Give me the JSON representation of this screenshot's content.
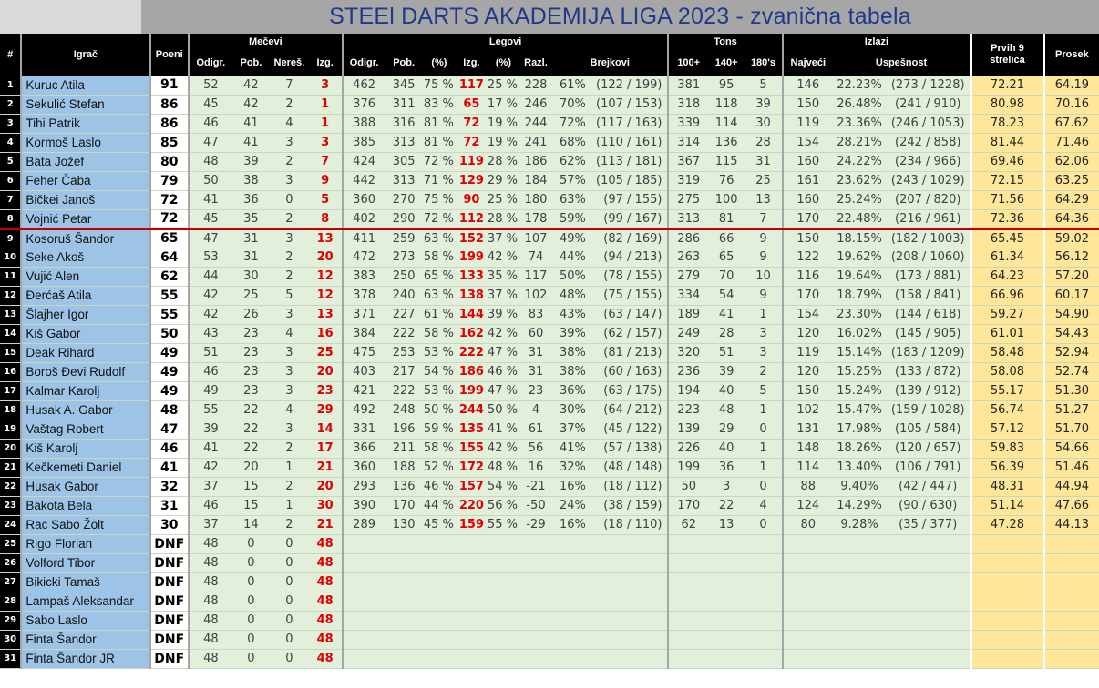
{
  "title": "STEEl DARTS AKADEMIJA LIGA 2023 - zvanična tabela",
  "colors": {
    "player_bg": "#9dc3e6",
    "stats_bg": "#e2efda",
    "highlight_bg": "#ffe699",
    "lost_red": "#e00000",
    "cut_line": "#c00000"
  },
  "headers": {
    "rank": "#",
    "player": "Igrač",
    "points": "Poeni",
    "matches": "Mečevi",
    "legs": "Legovi",
    "tons": "Tons",
    "checkouts": "Izlazi",
    "first9": "Prvih 9 strelica",
    "average": "Prosek",
    "m_played": "Odigr.",
    "m_won": "Pob.",
    "m_draw": "Nereš.",
    "m_lost": "Izg.",
    "l_played": "Odigr.",
    "l_won": "Pob.",
    "l_won_pct": "(%)",
    "l_lost": "Izg.",
    "l_lost_pct": "(%)",
    "l_diff": "Razl.",
    "l_breaks": "Brejkovi",
    "t_100": "100+",
    "t_140": "140+",
    "t_180": "180's",
    "c_highest": "Najveći",
    "c_success": "Uspešnost"
  },
  "rows": [
    {
      "rank": "1",
      "player": "Kuruc Atila",
      "points": "91",
      "mp": "52",
      "mw": "42",
      "md": "7",
      "ml": "3",
      "lp": "462",
      "lw": "345",
      "lwp": "75 %",
      "ll": "117",
      "llp": "25 %",
      "ld": "228",
      "bp": "61%",
      "bf": "(122 / 199)",
      "t100": "381",
      "t140": "95",
      "t180": "5",
      "ch": "146",
      "cp": "22.23%",
      "cf": "(273 / 1228)",
      "f9": "72.21",
      "avg": "64.19"
    },
    {
      "rank": "2",
      "player": "Sekulić Stefan",
      "points": "86",
      "mp": "45",
      "mw": "42",
      "md": "2",
      "ml": "1",
      "lp": "376",
      "lw": "311",
      "lwp": "83 %",
      "ll": "65",
      "llp": "17 %",
      "ld": "246",
      "bp": "70%",
      "bf": "(107 / 153)",
      "t100": "318",
      "t140": "118",
      "t180": "39",
      "ch": "150",
      "cp": "26.48%",
      "cf": "(241 / 910)",
      "f9": "80.98",
      "avg": "70.16"
    },
    {
      "rank": "3",
      "player": "Tihi Patrik",
      "points": "86",
      "mp": "46",
      "mw": "41",
      "md": "4",
      "ml": "1",
      "lp": "388",
      "lw": "316",
      "lwp": "81 %",
      "ll": "72",
      "llp": "19 %",
      "ld": "244",
      "bp": "72%",
      "bf": "(117 / 163)",
      "t100": "339",
      "t140": "114",
      "t180": "30",
      "ch": "119",
      "cp": "23.36%",
      "cf": "(246 / 1053)",
      "f9": "78.23",
      "avg": "67.62"
    },
    {
      "rank": "4",
      "player": "Kormoš Laslo",
      "points": "85",
      "mp": "47",
      "mw": "41",
      "md": "3",
      "ml": "3",
      "lp": "385",
      "lw": "313",
      "lwp": "81 %",
      "ll": "72",
      "llp": "19 %",
      "ld": "241",
      "bp": "68%",
      "bf": "(110 / 161)",
      "t100": "314",
      "t140": "136",
      "t180": "28",
      "ch": "154",
      "cp": "28.21%",
      "cf": "(242 / 858)",
      "f9": "81.44",
      "avg": "71.46"
    },
    {
      "rank": "5",
      "player": "Bata Jožef",
      "points": "80",
      "mp": "48",
      "mw": "39",
      "md": "2",
      "ml": "7",
      "lp": "424",
      "lw": "305",
      "lwp": "72 %",
      "ll": "119",
      "llp": "28 %",
      "ld": "186",
      "bp": "62%",
      "bf": "(113 / 181)",
      "t100": "367",
      "t140": "115",
      "t180": "31",
      "ch": "160",
      "cp": "24.22%",
      "cf": "(234 / 966)",
      "f9": "69.46",
      "avg": "62.06"
    },
    {
      "rank": "6",
      "player": "Feher Čaba",
      "points": "79",
      "mp": "50",
      "mw": "38",
      "md": "3",
      "ml": "9",
      "lp": "442",
      "lw": "313",
      "lwp": "71 %",
      "ll": "129",
      "llp": "29 %",
      "ld": "184",
      "bp": "57%",
      "bf": "(105 / 185)",
      "t100": "319",
      "t140": "76",
      "t180": "25",
      "ch": "161",
      "cp": "23.62%",
      "cf": "(243 / 1029)",
      "f9": "72.15",
      "avg": "63.25"
    },
    {
      "rank": "7",
      "player": "Bičkei Janoš",
      "points": "72",
      "mp": "41",
      "mw": "36",
      "md": "0",
      "ml": "5",
      "lp": "360",
      "lw": "270",
      "lwp": "75 %",
      "ll": "90",
      "llp": "25 %",
      "ld": "180",
      "bp": "63%",
      "bf": "(97 / 155)",
      "t100": "275",
      "t140": "100",
      "t180": "13",
      "ch": "160",
      "cp": "25.24%",
      "cf": "(207 / 820)",
      "f9": "71.56",
      "avg": "64.29"
    },
    {
      "rank": "8",
      "player": "Vojnić Petar",
      "points": "72",
      "mp": "45",
      "mw": "35",
      "md": "2",
      "ml": "8",
      "lp": "402",
      "lw": "290",
      "lwp": "72 %",
      "ll": "112",
      "llp": "28 %",
      "ld": "178",
      "bp": "59%",
      "bf": "(99 / 167)",
      "t100": "313",
      "t140": "81",
      "t180": "7",
      "ch": "170",
      "cp": "22.48%",
      "cf": "(216 / 961)",
      "f9": "72.36",
      "avg": "64.36"
    },
    {
      "rank": "9",
      "player": "Kosoruš Šandor",
      "points": "65",
      "mp": "47",
      "mw": "31",
      "md": "3",
      "ml": "13",
      "lp": "411",
      "lw": "259",
      "lwp": "63 %",
      "ll": "152",
      "llp": "37 %",
      "ld": "107",
      "bp": "49%",
      "bf": "(82 / 169)",
      "t100": "286",
      "t140": "66",
      "t180": "9",
      "ch": "150",
      "cp": "18.15%",
      "cf": "(182 / 1003)",
      "f9": "65.45",
      "avg": "59.02"
    },
    {
      "rank": "10",
      "player": "Seke Akoš",
      "points": "64",
      "mp": "53",
      "mw": "31",
      "md": "2",
      "ml": "20",
      "lp": "472",
      "lw": "273",
      "lwp": "58 %",
      "ll": "199",
      "llp": "42 %",
      "ld": "74",
      "bp": "44%",
      "bf": "(94 / 213)",
      "t100": "263",
      "t140": "65",
      "t180": "9",
      "ch": "122",
      "cp": "19.62%",
      "cf": "(208 / 1060)",
      "f9": "61.34",
      "avg": "56.12"
    },
    {
      "rank": "11",
      "player": "Vujić Alen",
      "points": "62",
      "mp": "44",
      "mw": "30",
      "md": "2",
      "ml": "12",
      "lp": "383",
      "lw": "250",
      "lwp": "65 %",
      "ll": "133",
      "llp": "35 %",
      "ld": "117",
      "bp": "50%",
      "bf": "(78 / 155)",
      "t100": "279",
      "t140": "70",
      "t180": "10",
      "ch": "116",
      "cp": "19.64%",
      "cf": "(173 / 881)",
      "f9": "64.23",
      "avg": "57.20"
    },
    {
      "rank": "12",
      "player": "Đerćaš Atila",
      "points": "55",
      "mp": "42",
      "mw": "25",
      "md": "5",
      "ml": "12",
      "lp": "378",
      "lw": "240",
      "lwp": "63 %",
      "ll": "138",
      "llp": "37 %",
      "ld": "102",
      "bp": "48%",
      "bf": "(75 / 155)",
      "t100": "334",
      "t140": "54",
      "t180": "9",
      "ch": "170",
      "cp": "18.79%",
      "cf": "(158 / 841)",
      "f9": "66.96",
      "avg": "60.17"
    },
    {
      "rank": "13",
      "player": "Šlajher Igor",
      "points": "55",
      "mp": "42",
      "mw": "26",
      "md": "3",
      "ml": "13",
      "lp": "371",
      "lw": "227",
      "lwp": "61 %",
      "ll": "144",
      "llp": "39 %",
      "ld": "83",
      "bp": "43%",
      "bf": "(63 / 147)",
      "t100": "189",
      "t140": "41",
      "t180": "1",
      "ch": "154",
      "cp": "23.30%",
      "cf": "(144 / 618)",
      "f9": "59.27",
      "avg": "54.90"
    },
    {
      "rank": "14",
      "player": "Kiš Gabor",
      "points": "50",
      "mp": "43",
      "mw": "23",
      "md": "4",
      "ml": "16",
      "lp": "384",
      "lw": "222",
      "lwp": "58 %",
      "ll": "162",
      "llp": "42 %",
      "ld": "60",
      "bp": "39%",
      "bf": "(62 / 157)",
      "t100": "249",
      "t140": "28",
      "t180": "3",
      "ch": "120",
      "cp": "16.02%",
      "cf": "(145 / 905)",
      "f9": "61.01",
      "avg": "54.43"
    },
    {
      "rank": "15",
      "player": "Deak Rihard",
      "points": "49",
      "mp": "51",
      "mw": "23",
      "md": "3",
      "ml": "25",
      "lp": "475",
      "lw": "253",
      "lwp": "53 %",
      "ll": "222",
      "llp": "47 %",
      "ld": "31",
      "bp": "38%",
      "bf": "(81 / 213)",
      "t100": "320",
      "t140": "51",
      "t180": "3",
      "ch": "119",
      "cp": "15.14%",
      "cf": "(183 / 1209)",
      "f9": "58.48",
      "avg": "52.94"
    },
    {
      "rank": "16",
      "player": "Boroš Đevi Rudolf",
      "points": "49",
      "mp": "46",
      "mw": "23",
      "md": "3",
      "ml": "20",
      "lp": "403",
      "lw": "217",
      "lwp": "54 %",
      "ll": "186",
      "llp": "46 %",
      "ld": "31",
      "bp": "38%",
      "bf": "(60 / 163)",
      "t100": "236",
      "t140": "39",
      "t180": "2",
      "ch": "120",
      "cp": "15.25%",
      "cf": "(133 / 872)",
      "f9": "58.08",
      "avg": "52.74"
    },
    {
      "rank": "17",
      "player": "Kalmar Karolj",
      "points": "49",
      "mp": "49",
      "mw": "23",
      "md": "3",
      "ml": "23",
      "lp": "421",
      "lw": "222",
      "lwp": "53 %",
      "ll": "199",
      "llp": "47 %",
      "ld": "23",
      "bp": "36%",
      "bf": "(63 / 175)",
      "t100": "194",
      "t140": "40",
      "t180": "5",
      "ch": "150",
      "cp": "15.24%",
      "cf": "(139 / 912)",
      "f9": "55.17",
      "avg": "51.30"
    },
    {
      "rank": "18",
      "player": "Husak A. Gabor",
      "points": "48",
      "mp": "55",
      "mw": "22",
      "md": "4",
      "ml": "29",
      "lp": "492",
      "lw": "248",
      "lwp": "50 %",
      "ll": "244",
      "llp": "50 %",
      "ld": "4",
      "bp": "30%",
      "bf": "(64 / 212)",
      "t100": "223",
      "t140": "48",
      "t180": "1",
      "ch": "102",
      "cp": "15.47%",
      "cf": "(159 / 1028)",
      "f9": "56.74",
      "avg": "51.27"
    },
    {
      "rank": "19",
      "player": "Vaštag Robert",
      "points": "47",
      "mp": "39",
      "mw": "22",
      "md": "3",
      "ml": "14",
      "lp": "331",
      "lw": "196",
      "lwp": "59 %",
      "ll": "135",
      "llp": "41 %",
      "ld": "61",
      "bp": "37%",
      "bf": "(45 / 122)",
      "t100": "139",
      "t140": "29",
      "t180": "0",
      "ch": "131",
      "cp": "17.98%",
      "cf": "(105 / 584)",
      "f9": "57.12",
      "avg": "51.70"
    },
    {
      "rank": "20",
      "player": "Kiš Karolj",
      "points": "46",
      "mp": "41",
      "mw": "22",
      "md": "2",
      "ml": "17",
      "lp": "366",
      "lw": "211",
      "lwp": "58 %",
      "ll": "155",
      "llp": "42 %",
      "ld": "56",
      "bp": "41%",
      "bf": "(57 / 138)",
      "t100": "226",
      "t140": "40",
      "t180": "1",
      "ch": "148",
      "cp": "18.26%",
      "cf": "(120 / 657)",
      "f9": "59.83",
      "avg": "54.66"
    },
    {
      "rank": "21",
      "player": "Kečkemeti Daniel",
      "points": "41",
      "mp": "42",
      "mw": "20",
      "md": "1",
      "ml": "21",
      "lp": "360",
      "lw": "188",
      "lwp": "52 %",
      "ll": "172",
      "llp": "48 %",
      "ld": "16",
      "bp": "32%",
      "bf": "(48 / 148)",
      "t100": "199",
      "t140": "36",
      "t180": "1",
      "ch": "114",
      "cp": "13.40%",
      "cf": "(106 / 791)",
      "f9": "56.39",
      "avg": "51.46"
    },
    {
      "rank": "22",
      "player": "Husak Gabor",
      "points": "32",
      "mp": "37",
      "mw": "15",
      "md": "2",
      "ml": "20",
      "lp": "293",
      "lw": "136",
      "lwp": "46 %",
      "ll": "157",
      "llp": "54 %",
      "ld": "-21",
      "bp": "16%",
      "bf": "(18 / 112)",
      "t100": "50",
      "t140": "3",
      "t180": "0",
      "ch": "88",
      "cp": "9.40%",
      "cf": "(42 / 447)",
      "f9": "48.31",
      "avg": "44.94"
    },
    {
      "rank": "23",
      "player": "Bakota Bela",
      "points": "31",
      "mp": "46",
      "mw": "15",
      "md": "1",
      "ml": "30",
      "lp": "390",
      "lw": "170",
      "lwp": "44 %",
      "ll": "220",
      "llp": "56 %",
      "ld": "-50",
      "bp": "24%",
      "bf": "(38 / 159)",
      "t100": "170",
      "t140": "22",
      "t180": "4",
      "ch": "124",
      "cp": "14.29%",
      "cf": "(90 / 630)",
      "f9": "51.14",
      "avg": "47.66"
    },
    {
      "rank": "24",
      "player": "Rac Sabo Žolt",
      "points": "30",
      "mp": "37",
      "mw": "14",
      "md": "2",
      "ml": "21",
      "lp": "289",
      "lw": "130",
      "lwp": "45 %",
      "ll": "159",
      "llp": "55 %",
      "ld": "-29",
      "bp": "16%",
      "bf": "(18 / 110)",
      "t100": "62",
      "t140": "13",
      "t180": "0",
      "ch": "80",
      "cp": "9.28%",
      "cf": "(35 / 377)",
      "f9": "47.28",
      "avg": "44.13"
    },
    {
      "rank": "25",
      "player": "Rigo Florian",
      "points": "DNF",
      "mp": "48",
      "mw": "0",
      "md": "0",
      "ml": "48",
      "lp": "",
      "lw": "",
      "lwp": "",
      "ll": "",
      "llp": "",
      "ld": "",
      "bp": "",
      "bf": "",
      "t100": "",
      "t140": "",
      "t180": "",
      "ch": "",
      "cp": "",
      "cf": "",
      "f9": "",
      "avg": ""
    },
    {
      "rank": "26",
      "player": "Volford Tibor",
      "points": "DNF",
      "mp": "48",
      "mw": "0",
      "md": "0",
      "ml": "48",
      "lp": "",
      "lw": "",
      "lwp": "",
      "ll": "",
      "llp": "",
      "ld": "",
      "bp": "",
      "bf": "",
      "t100": "",
      "t140": "",
      "t180": "",
      "ch": "",
      "cp": "",
      "cf": "",
      "f9": "",
      "avg": ""
    },
    {
      "rank": "27",
      "player": "Bikicki Tamaš",
      "points": "DNF",
      "mp": "48",
      "mw": "0",
      "md": "0",
      "ml": "48",
      "lp": "",
      "lw": "",
      "lwp": "",
      "ll": "",
      "llp": "",
      "ld": "",
      "bp": "",
      "bf": "",
      "t100": "",
      "t140": "",
      "t180": "",
      "ch": "",
      "cp": "",
      "cf": "",
      "f9": "",
      "avg": ""
    },
    {
      "rank": "28",
      "player": "Lampaš Aleksandar",
      "points": "DNF",
      "mp": "48",
      "mw": "0",
      "md": "0",
      "ml": "48",
      "lp": "",
      "lw": "",
      "lwp": "",
      "ll": "",
      "llp": "",
      "ld": "",
      "bp": "",
      "bf": "",
      "t100": "",
      "t140": "",
      "t180": "",
      "ch": "",
      "cp": "",
      "cf": "",
      "f9": "",
      "avg": ""
    },
    {
      "rank": "29",
      "player": "Sabo Laslo",
      "points": "DNF",
      "mp": "48",
      "mw": "0",
      "md": "0",
      "ml": "48",
      "lp": "",
      "lw": "",
      "lwp": "",
      "ll": "",
      "llp": "",
      "ld": "",
      "bp": "",
      "bf": "",
      "t100": "",
      "t140": "",
      "t180": "",
      "ch": "",
      "cp": "",
      "cf": "",
      "f9": "",
      "avg": ""
    },
    {
      "rank": "30",
      "player": "Finta Šandor",
      "points": "DNF",
      "mp": "48",
      "mw": "0",
      "md": "0",
      "ml": "48",
      "lp": "",
      "lw": "",
      "lwp": "",
      "ll": "",
      "llp": "",
      "ld": "",
      "bp": "",
      "bf": "",
      "t100": "",
      "t140": "",
      "t180": "",
      "ch": "",
      "cp": "",
      "cf": "",
      "f9": "",
      "avg": ""
    },
    {
      "rank": "31",
      "player": "Finta Šandor JR",
      "points": "DNF",
      "mp": "48",
      "mw": "0",
      "md": "0",
      "ml": "48",
      "lp": "",
      "lw": "",
      "lwp": "",
      "ll": "",
      "llp": "",
      "ld": "",
      "bp": "",
      "bf": "",
      "t100": "",
      "t140": "",
      "t180": "",
      "ch": "",
      "cp": "",
      "cf": "",
      "f9": "",
      "avg": ""
    }
  ]
}
